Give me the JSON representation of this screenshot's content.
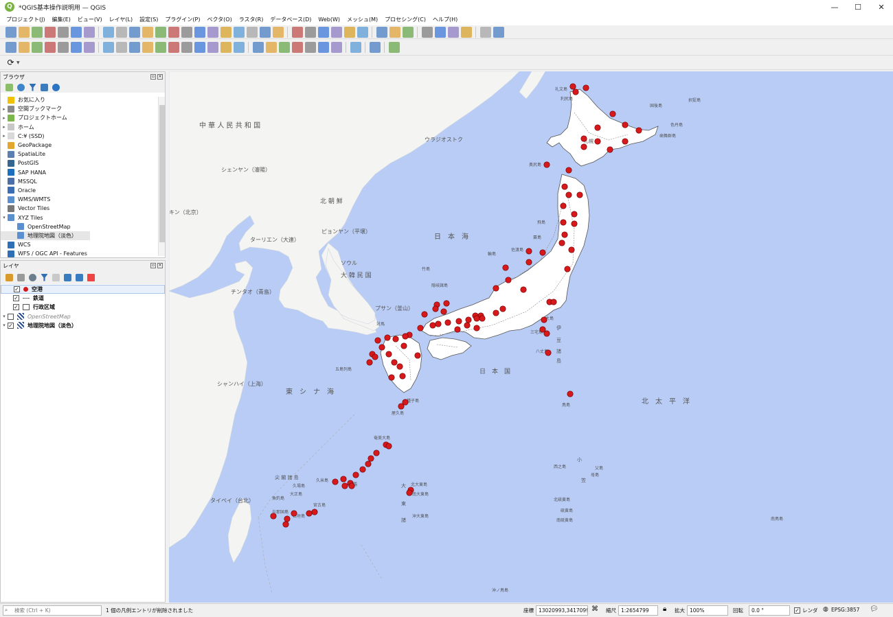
{
  "window": {
    "title": "*QGIS基本操作説明用 — QGIS",
    "logo": "Q",
    "minimize": "—",
    "maximize": "☐",
    "close": "✕"
  },
  "menu": [
    "プロジェクト(J)",
    "編集(E)",
    "ビュー(V)",
    "レイヤ(L)",
    "設定(S)",
    "プラグイン(P)",
    "ベクタ(O)",
    "ラスタ(R)",
    "データベース(D)",
    "Web(W)",
    "メッシュ(M)",
    "プロセシング(C)",
    "ヘルプ(H)"
  ],
  "browser": {
    "title": "ブラウザ",
    "items": [
      {
        "label": "お気に入り",
        "icon": "star-icon",
        "expand": ""
      },
      {
        "label": "空間ブックマーク",
        "icon": "bookmark-icon",
        "expand": "▸"
      },
      {
        "label": "プロジェクトホーム",
        "icon": "project-home-icon",
        "expand": "▸"
      },
      {
        "label": "ホーム",
        "icon": "home-folder-icon",
        "expand": "▸"
      },
      {
        "label": "C:¥ (SSD)",
        "icon": "drive-icon",
        "expand": "▸"
      },
      {
        "label": "GeoPackage",
        "icon": "geopackage-icon",
        "expand": ""
      },
      {
        "label": "SpatiaLite",
        "icon": "spatialite-icon",
        "expand": ""
      },
      {
        "label": "PostGIS",
        "icon": "postgis-icon",
        "expand": ""
      },
      {
        "label": "SAP HANA",
        "icon": "sap-hana-icon",
        "expand": ""
      },
      {
        "label": "MSSQL",
        "icon": "mssql-icon",
        "expand": ""
      },
      {
        "label": "Oracle",
        "icon": "oracle-icon",
        "expand": ""
      },
      {
        "label": "WMS/WMTS",
        "icon": "wms-icon",
        "expand": ""
      },
      {
        "label": "Vector Tiles",
        "icon": "vector-tiles-icon",
        "expand": ""
      },
      {
        "label": "XYZ Tiles",
        "icon": "xyz-tiles-icon",
        "expand": "▾"
      },
      {
        "label": "OpenStreetMap",
        "icon": "xyz-tile-layer-icon",
        "expand": "",
        "indent": true
      },
      {
        "label": "地理院地図（淡色）",
        "icon": "xyz-tile-layer-icon",
        "expand": "",
        "indent": true,
        "selected": true
      },
      {
        "label": "WCS",
        "icon": "wcs-icon",
        "expand": ""
      },
      {
        "label": "WFS / OGC API - Features",
        "icon": "wfs-icon",
        "expand": ""
      }
    ]
  },
  "layers": {
    "title": "レイヤ",
    "items": [
      {
        "label": "空港",
        "checked": true,
        "symbol": "red-point",
        "bold": true,
        "selected": true,
        "group": false
      },
      {
        "label": "鉄道",
        "checked": true,
        "symbol": "dashed-line",
        "bold": true,
        "group": false
      },
      {
        "label": "行政区域",
        "checked": true,
        "symbol": "polygon",
        "bold": true,
        "group": false
      },
      {
        "label": "OpenStreetMap",
        "checked": false,
        "symbol": "raster",
        "bold": false,
        "italic": true,
        "group": true
      },
      {
        "label": "地理院地図（淡色）",
        "checked": true,
        "symbol": "raster",
        "bold": true,
        "group": true
      }
    ]
  },
  "status": {
    "search_placeholder": "検索 (Ctrl + K)",
    "message": "1 個の凡例エントリが削除されました",
    "coord_label": "座標",
    "coord_value": "13020993,3417099",
    "scale_label": "縮尺",
    "scale_value": "1:2654799",
    "magnify_label": "拡大",
    "magnify_value": "100%",
    "rotation_label": "回転",
    "rotation_value": "0.0 °",
    "render_label": "レンダ",
    "crs": "EPSG:3857"
  },
  "map_labels": [
    {
      "text": "中 華 人 民 共 和 国",
      "key": "china"
    },
    {
      "text": "ウラジオストク",
      "key": "vladivostok"
    },
    {
      "text": "シェンヤン（瀋陽）",
      "key": "shenyang"
    },
    {
      "text": "北 朝 鮮",
      "key": "north-korea"
    },
    {
      "text": "キン（北京）",
      "key": "beijing"
    },
    {
      "text": "ピョンヤン（平壌）",
      "key": "pyongyang"
    },
    {
      "text": "ターリエン（大連）",
      "key": "dalian"
    },
    {
      "text": "ソウル",
      "key": "seoul"
    },
    {
      "text": "大 韓 民 国",
      "key": "south-korea"
    },
    {
      "text": "チンタオ（青島）",
      "key": "qingdao"
    },
    {
      "text": "プサン（釜山）",
      "key": "busan"
    },
    {
      "text": "日　本　海",
      "key": "sea-of-japan"
    },
    {
      "text": "竹島",
      "key": "takeshima"
    },
    {
      "text": "隠岐諸島",
      "key": "oki"
    },
    {
      "text": "佐渡島",
      "key": "sado"
    },
    {
      "text": "輪島",
      "key": "wajima"
    },
    {
      "text": "粟島",
      "key": "awashima"
    },
    {
      "text": "飛島",
      "key": "tobishima"
    },
    {
      "text": "奥尻島",
      "key": "okushiri"
    },
    {
      "text": "利尻島",
      "key": "rishiri"
    },
    {
      "text": "礼文島",
      "key": "rebun"
    },
    {
      "text": "国後島",
      "key": "kunashiri"
    },
    {
      "text": "択捉島",
      "key": "etorofu"
    },
    {
      "text": "色丹島",
      "key": "shikotan"
    },
    {
      "text": "歯舞群島",
      "key": "habomai"
    },
    {
      "text": "札幌",
      "key": "sapporo"
    },
    {
      "text": "対馬",
      "key": "tsushima"
    },
    {
      "text": "五島列島",
      "key": "goto"
    },
    {
      "text": "シャンハイ（上海）",
      "key": "shanghai"
    },
    {
      "text": "東　シ　ナ　海",
      "key": "east-china-sea"
    },
    {
      "text": "日　本　国",
      "key": "japan"
    },
    {
      "text": "大島",
      "key": "oshima"
    },
    {
      "text": "三宅島",
      "key": "miyake"
    },
    {
      "text": "八丈島",
      "key": "hachijo"
    },
    {
      "text": "伊",
      "key": "izu1"
    },
    {
      "text": "豆",
      "key": "izu2"
    },
    {
      "text": "諸",
      "key": "izu3"
    },
    {
      "text": "島",
      "key": "izu4"
    },
    {
      "text": "鳥島",
      "key": "torishima"
    },
    {
      "text": "種子島",
      "key": "tanegashima"
    },
    {
      "text": "屋久島",
      "key": "yakushima"
    },
    {
      "text": "奄美大島",
      "key": "amami"
    },
    {
      "text": "北　太　平　洋",
      "key": "north-pacific"
    },
    {
      "text": "西之島",
      "key": "nishinoshima"
    },
    {
      "text": "父島",
      "key": "chichijima"
    },
    {
      "text": "母島",
      "key": "hahajima"
    },
    {
      "text": "小",
      "key": "ogasawara1"
    },
    {
      "text": "笠",
      "key": "ogasawara2"
    },
    {
      "text": "北硫黄島",
      "key": "kitaio"
    },
    {
      "text": "硫黄島",
      "key": "iojima"
    },
    {
      "text": "南硫黄島",
      "key": "minamiio"
    },
    {
      "text": "南鳥島",
      "key": "minamitori"
    },
    {
      "text": "沖ノ鳥島",
      "key": "okinotori"
    },
    {
      "text": "那覇",
      "key": "naha"
    },
    {
      "text": "久米島",
      "key": "kume"
    },
    {
      "text": "尖 閣 諸 島",
      "key": "senkaku"
    },
    {
      "text": "久場島",
      "key": "kuba"
    },
    {
      "text": "魚釣島",
      "key": "uotsuri"
    },
    {
      "text": "大正島",
      "key": "taisho"
    },
    {
      "text": "宮古島",
      "key": "miyako"
    },
    {
      "text": "石垣島",
      "key": "ishigaki"
    },
    {
      "text": "与那国島",
      "key": "yonaguni"
    },
    {
      "text": "北大東島",
      "key": "kitadaito"
    },
    {
      "text": "南大東島",
      "key": "minamidaito"
    },
    {
      "text": "沖大東島",
      "key": "okidaito"
    },
    {
      "text": "大",
      "key": "daito1"
    },
    {
      "text": "東",
      "key": "daito2"
    },
    {
      "text": "諸",
      "key": "daito3"
    },
    {
      "text": "タイペイ（台北）",
      "key": "taipei"
    }
  ]
}
